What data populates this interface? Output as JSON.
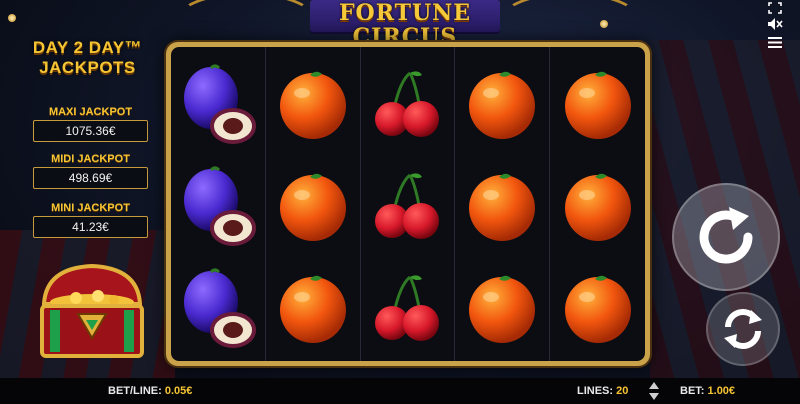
{
  "game": {
    "logo_line1": "FORTUNE",
    "logo_line2": "CIRCUS"
  },
  "jackpots": {
    "title_line1": "DAY 2 DAY™",
    "title_line2": "JACKPOTS",
    "items": [
      {
        "label": "MAXI JACKPOT",
        "value": "1075.36€"
      },
      {
        "label": "MIDI JACKPOT",
        "value": "498.69€"
      },
      {
        "label": "MINI JACKPOT",
        "value": "41.23€"
      }
    ]
  },
  "reels": [
    [
      "plum",
      "plum",
      "plum"
    ],
    [
      "orange",
      "orange",
      "orange"
    ],
    [
      "cherry",
      "cherry",
      "cherry"
    ],
    [
      "orange",
      "orange",
      "orange"
    ],
    [
      "orange",
      "orange",
      "orange"
    ]
  ],
  "controls": {
    "spin_icon": "spin-icon",
    "autoplay_icon": "autoplay-icon",
    "fullscreen_icon": "fullscreen-icon",
    "sound_icon": "sound-muted-icon",
    "menu_icon": "menu-icon"
  },
  "bottom_bar": {
    "bet_line_label": "BET/LINE:",
    "bet_line_value": "0.05€",
    "lines_label": "LINES:",
    "lines_value": "20",
    "bet_label": "BET:",
    "bet_value": "1.00€"
  },
  "colors": {
    "gold": "#f6c534",
    "frame": "#c9a24a",
    "cherry": "#d8192b",
    "orange": "#f2560e",
    "plum": "#4a2ad0"
  }
}
